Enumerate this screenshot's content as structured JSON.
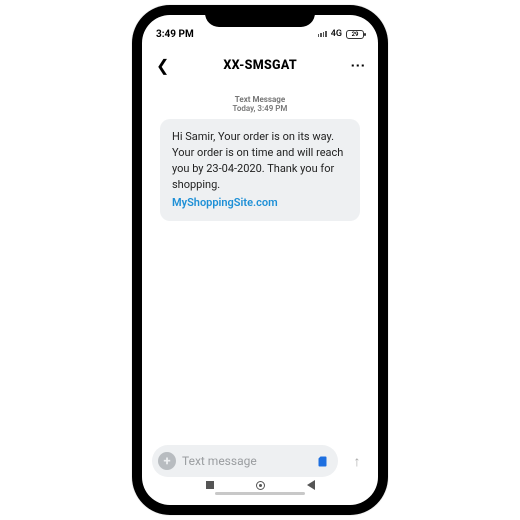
{
  "status": {
    "time": "3:49 PM",
    "network": "4G",
    "battery": "29"
  },
  "header": {
    "sender": "XX-SMSGAT"
  },
  "thread": {
    "type_label": "Text Message",
    "timestamp": "Today, 3:49 PM",
    "message_body": "Hi Samir, Your order is on its way. Your order is on time and will reach you by 23-04-2020. Thank you for shopping.",
    "message_link": "MyShoppingSite.com"
  },
  "composer": {
    "placeholder": "Text message"
  }
}
